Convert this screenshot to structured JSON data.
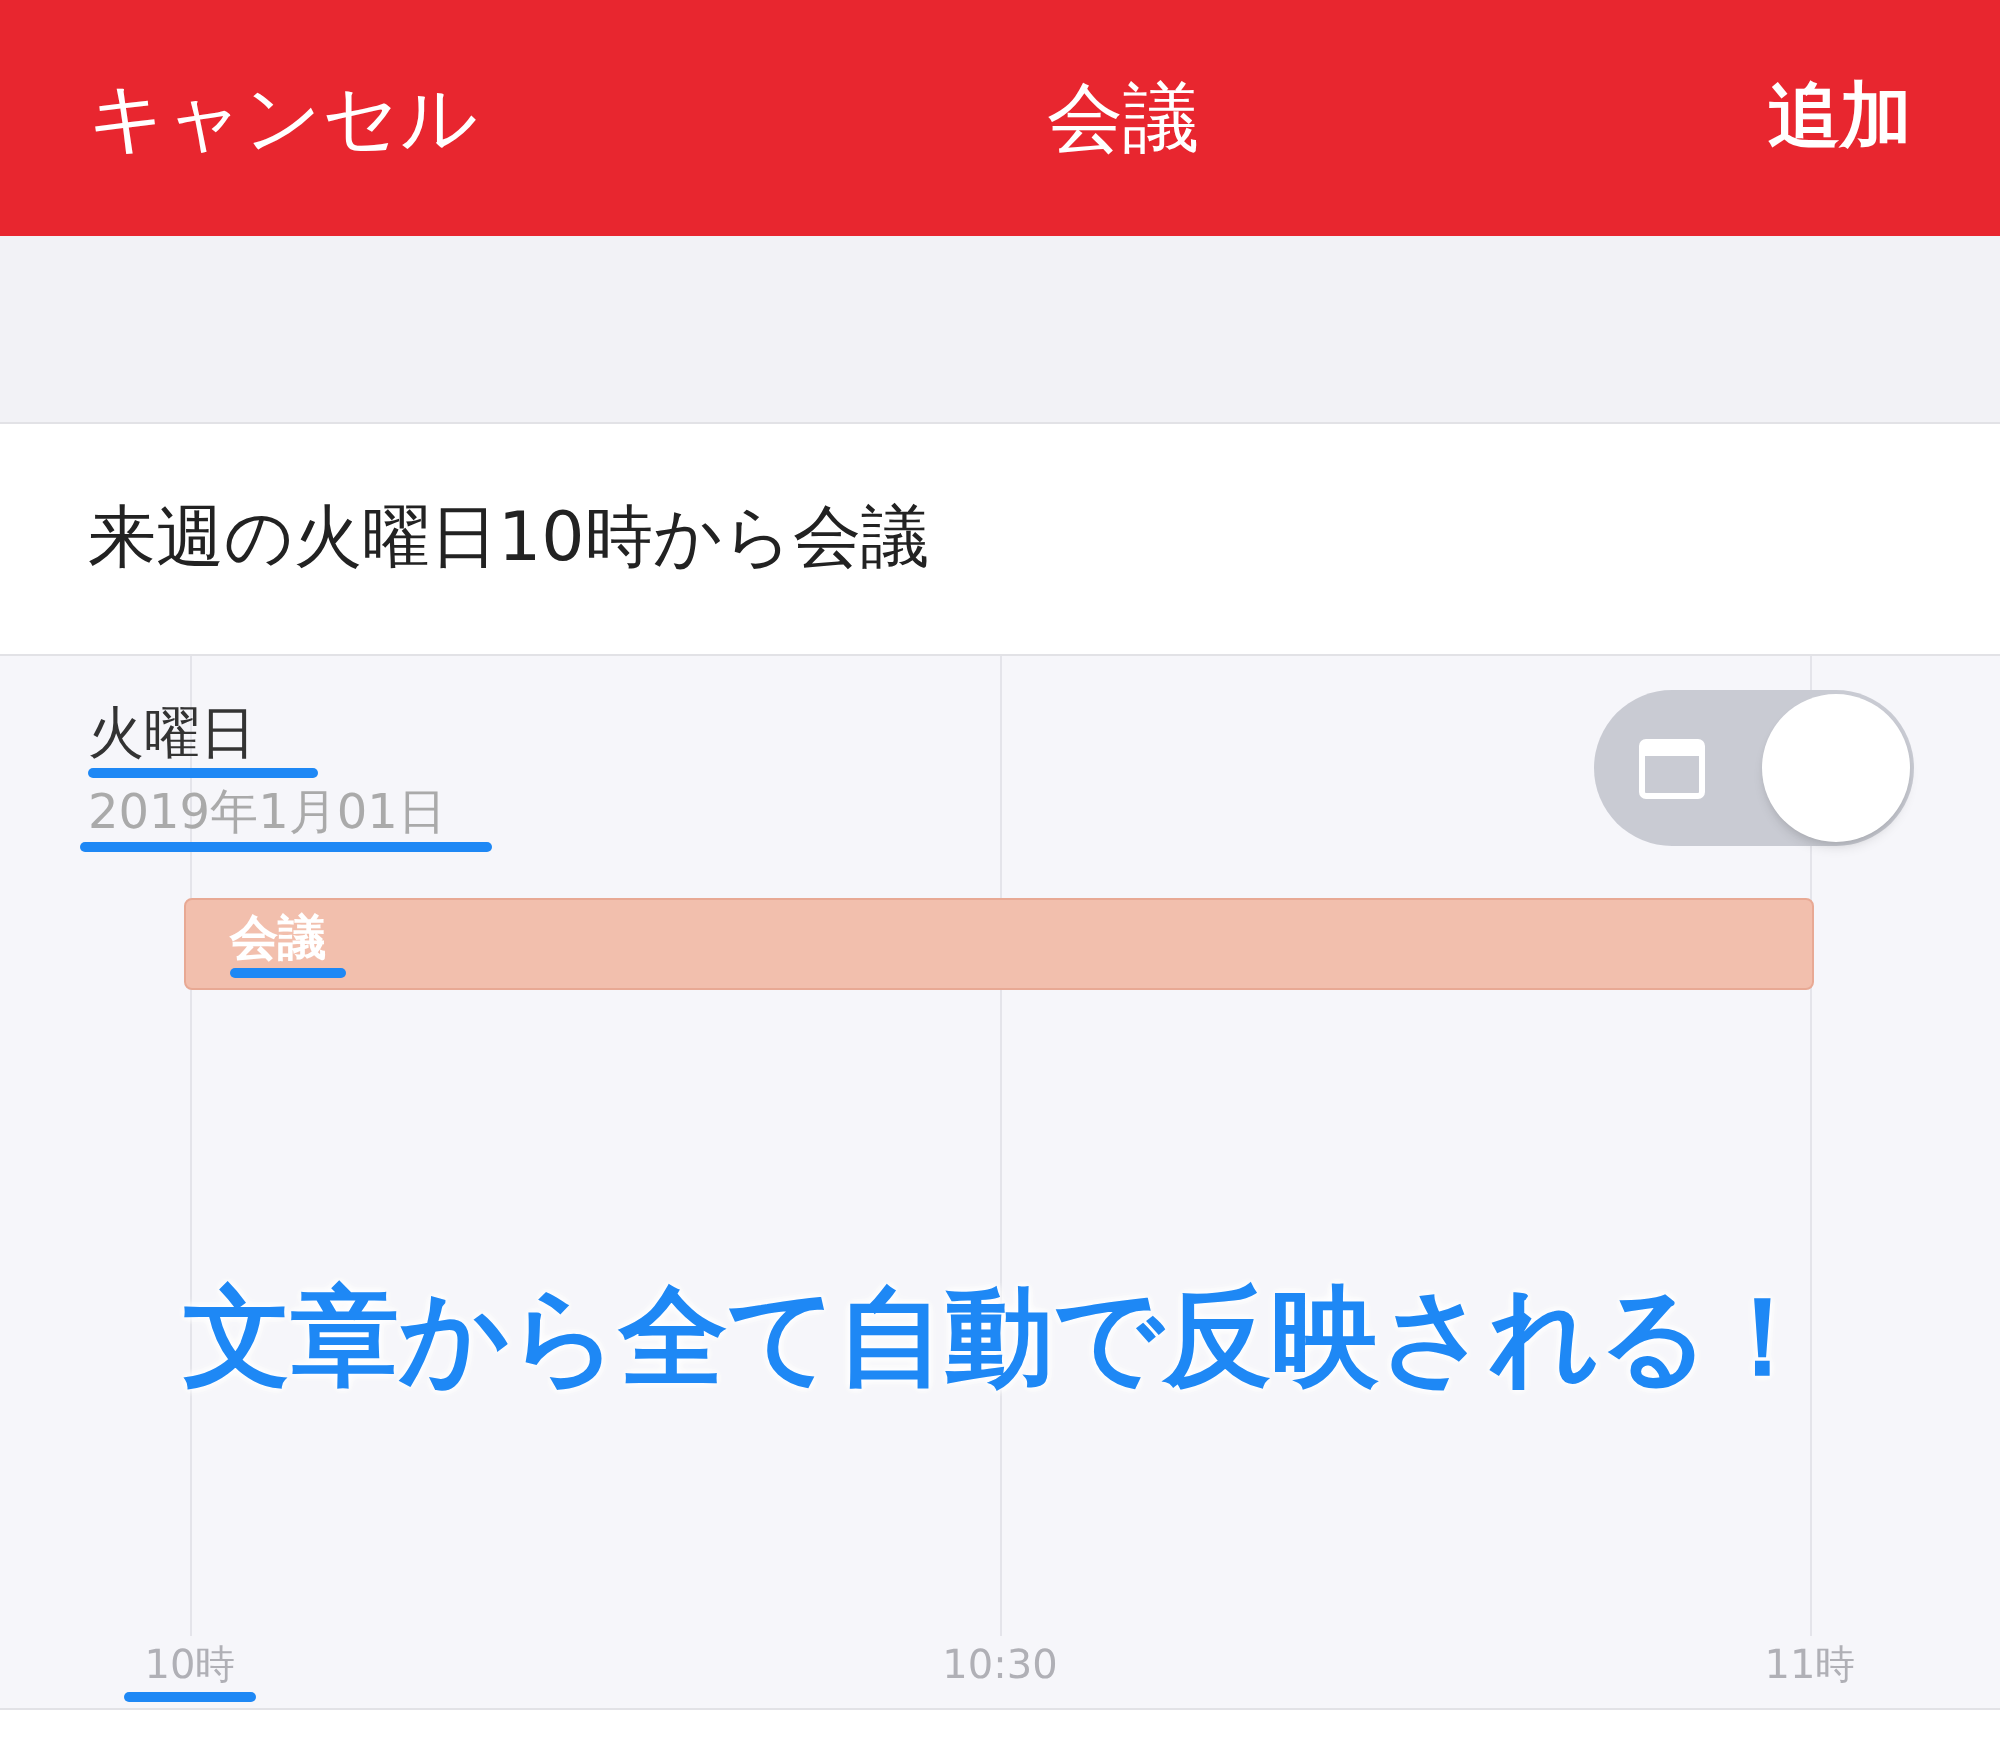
{
  "header": {
    "cancel": "キャンセル",
    "title": "会議",
    "add": "追加"
  },
  "input": {
    "value": "来週の火曜日10時から会議"
  },
  "day": {
    "weekday": "火曜日",
    "date": "2019年1月01日"
  },
  "toggle": {
    "on": true
  },
  "event": {
    "title": "会議"
  },
  "axis": [
    {
      "label": "10時",
      "underlined": true
    },
    {
      "label": "10:30",
      "underlined": false
    },
    {
      "label": "11時",
      "underlined": false
    }
  ],
  "caption": "文章から全て自動で反映される！"
}
